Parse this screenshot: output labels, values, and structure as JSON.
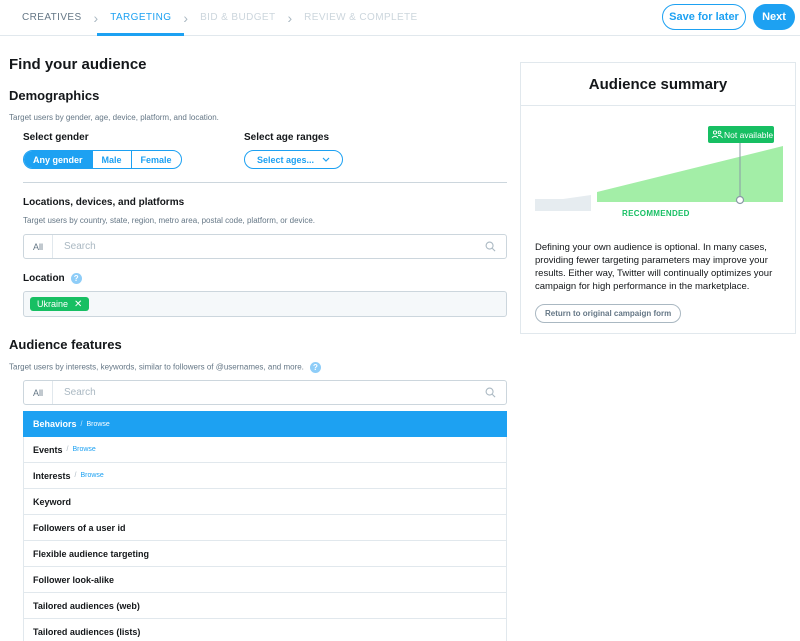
{
  "steps": [
    {
      "label": "CREATIVES",
      "state": "done"
    },
    {
      "label": "TARGETING",
      "state": "active"
    },
    {
      "label": "BID & BUDGET",
      "state": "disabled"
    },
    {
      "label": "REVIEW & COMPLETE",
      "state": "disabled"
    }
  ],
  "header": {
    "save_label": "Save for later",
    "next_label": "Next"
  },
  "page_title": "Find your audience",
  "demographics": {
    "title": "Demographics",
    "subtitle": "Target users by gender, age, device, platform, and location.",
    "gender_label": "Select gender",
    "gender_options": [
      "Any gender",
      "Male",
      "Female"
    ],
    "gender_selected": "Any gender",
    "age_label": "Select age ranges",
    "age_button": "Select ages..."
  },
  "locations": {
    "title": "Locations, devices, and platforms",
    "subtitle": "Target users by country, state, region, metro area, postal code, platform, or device.",
    "search_all": "All",
    "search_placeholder": "Search",
    "location_label": "Location",
    "help_glyph": "?",
    "chips": [
      "Ukraine"
    ],
    "chip_remove_glyph": "✕"
  },
  "features": {
    "title": "Audience features",
    "subtitle": "Target users by interests, keywords, similar to followers of @usernames, and more.",
    "search_all": "All",
    "search_placeholder": "Search",
    "browse_label": "Browse",
    "items": [
      {
        "label": "Behaviors",
        "browse": true,
        "selected": true
      },
      {
        "label": "Events",
        "browse": true,
        "selected": false
      },
      {
        "label": "Interests",
        "browse": true,
        "selected": false
      },
      {
        "label": "Keyword",
        "browse": false,
        "selected": false
      },
      {
        "label": "Followers of a user id",
        "browse": false,
        "selected": false
      },
      {
        "label": "Flexible audience targeting",
        "browse": false,
        "selected": false
      },
      {
        "label": "Follower look-alike",
        "browse": false,
        "selected": false
      },
      {
        "label": "Tailored audiences (web)",
        "browse": false,
        "selected": false
      },
      {
        "label": "Tailored audiences (lists)",
        "browse": false,
        "selected": false
      }
    ]
  },
  "summary": {
    "title": "Audience summary",
    "badge": "Not available",
    "recommended_label": "RECOMMENDED",
    "text": "Defining your own audience is optional. In many cases, providing fewer targeting parameters may improve your results. Either way, Twitter will continually optimizes your campaign for high performance in the marketplace.",
    "return_button": "Return to original campaign form"
  },
  "colors": {
    "accent": "#1da1f2",
    "success": "#17bf63",
    "chart_fill": "#a3eea7"
  }
}
